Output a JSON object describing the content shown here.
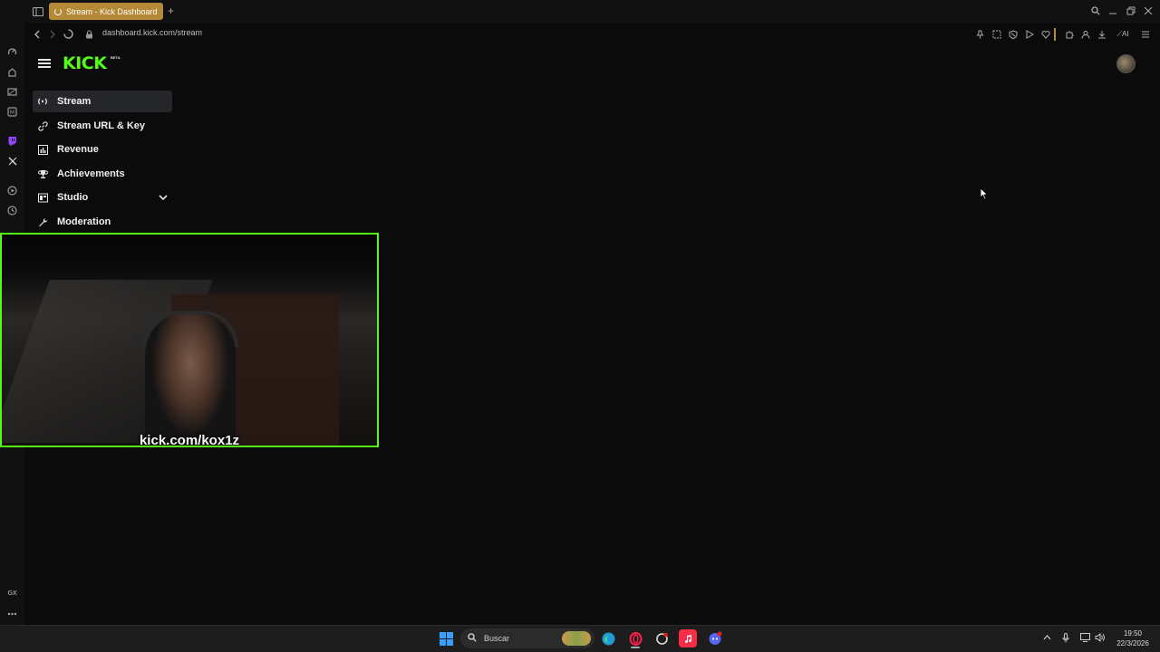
{
  "browser": {
    "tab_title": "Stream - Kick Dashboard",
    "new_tab": "+",
    "url": "dashboard.kick.com/stream"
  },
  "kick": {
    "logo": "KICK",
    "beta": "BETA",
    "nav": [
      {
        "label": "Stream",
        "icon": "broadcast-icon",
        "active": true
      },
      {
        "label": "Stream URL & Key",
        "icon": "link-icon"
      },
      {
        "label": "Revenue",
        "icon": "chart-icon"
      },
      {
        "label": "Achievements",
        "icon": "trophy-icon"
      },
      {
        "label": "Studio",
        "icon": "studio-icon"
      },
      {
        "label": "Moderation",
        "icon": "wrench-icon"
      }
    ]
  },
  "webcam": {
    "overlay_text": "kick.com/kox1z",
    "border_color": "#53fc18"
  },
  "taskbar": {
    "search_placeholder": "Buscar",
    "time": "19:50",
    "date": "22/3/2026"
  },
  "colors": {
    "kick_green": "#53fc18",
    "tab_active": "#b58a36"
  }
}
